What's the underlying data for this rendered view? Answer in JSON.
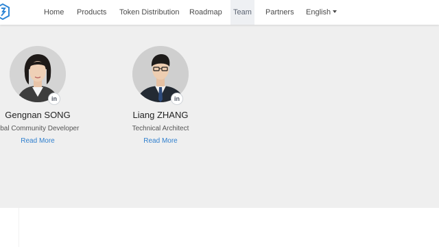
{
  "nav": {
    "items": [
      {
        "label": "Home"
      },
      {
        "label": "Products"
      },
      {
        "label": "Token Distribution"
      },
      {
        "label": "Roadmap"
      },
      {
        "label": "Team"
      },
      {
        "label": "Partners"
      },
      {
        "label": "English"
      }
    ],
    "active": "Team",
    "accent_color": "#2f7fce"
  },
  "team": {
    "members": [
      {
        "name": "Gengnan SONG",
        "role": "obal Community Developer",
        "link_label": "Read More",
        "social_icon": "linkedin-icon",
        "social_text": "in"
      },
      {
        "name": "Liang ZHANG",
        "role": "Technical Architect",
        "link_label": "Read More",
        "social_icon": "linkedin-icon",
        "social_text": "in"
      }
    ]
  }
}
